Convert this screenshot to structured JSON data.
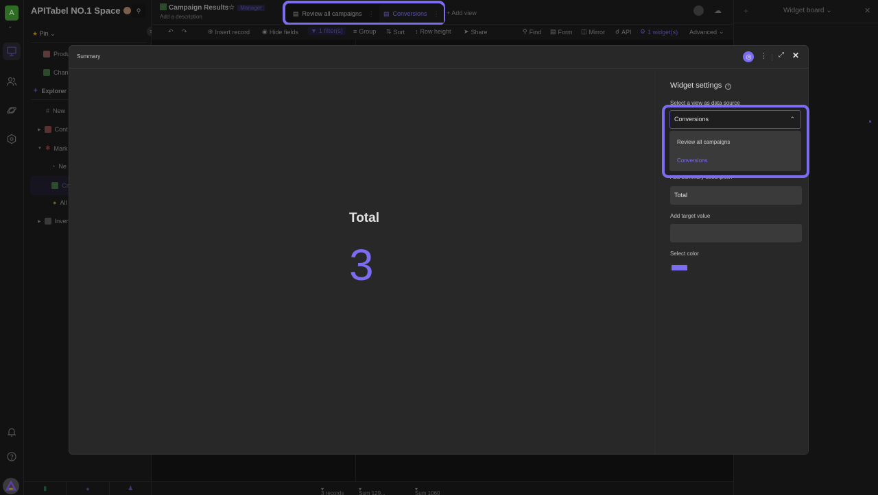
{
  "workspace": {
    "avatar_letter": "A",
    "space_name": "APITabel NO.1 Space",
    "pin_label": "Pin",
    "explorer_label": "Explorer"
  },
  "sidebar": {
    "items": [
      {
        "label": "Produ",
        "icon": "inbox-icon"
      },
      {
        "label": "Chan",
        "icon": "bar-chart-icon"
      },
      {
        "label": "New",
        "icon": "hash-icon"
      },
      {
        "label": "Cont",
        "icon": "calendar-icon"
      },
      {
        "label": "Mark",
        "icon": "pushpin-icon"
      },
      {
        "label": "Ne",
        "icon": "pie-icon"
      },
      {
        "label": "Ca",
        "icon": "bar-chart-icon",
        "active": true
      },
      {
        "label": "All",
        "icon": "bulb-icon"
      },
      {
        "label": "Inver",
        "icon": "cabinet-icon"
      }
    ]
  },
  "header": {
    "sheet_title": "Campaign Results",
    "role_badge": "Manager",
    "description_placeholder": "Add a description",
    "views": [
      {
        "label": "Review all campaigns",
        "active": false
      },
      {
        "label": "Conversions",
        "active": true
      }
    ],
    "add_view_label": "+ Add view"
  },
  "toolbar": {
    "insert_record": "Insert record",
    "hide_fields": "Hide fields",
    "filter": "1 filter(s)",
    "group": "Group",
    "sort": "Sort",
    "row_height": "Row height",
    "share": "Share",
    "find": "Find",
    "form": "Form",
    "mirror": "Mirror",
    "api": "API",
    "widgets": "1 widget(s)",
    "advanced": "Advanced"
  },
  "widget_board": {
    "title": "Widget board"
  },
  "footer": {
    "records": "3 records",
    "sum1": "Sum 129...",
    "sum2": "Sum 1060"
  },
  "modal": {
    "title": "Summary",
    "summary_label": "Total",
    "summary_value": "3",
    "settings": {
      "title": "Widget settings",
      "data_source_label": "Select a view as data source",
      "data_source_value": "Conversions",
      "data_source_options": [
        "Review all campaigns",
        "Conversions"
      ],
      "summary_desc_label": "Add summary description",
      "summary_desc_value": "Total",
      "target_label": "Add target value",
      "target_value": "",
      "color_label": "Select color",
      "color_value": "#7b6cf0"
    }
  }
}
